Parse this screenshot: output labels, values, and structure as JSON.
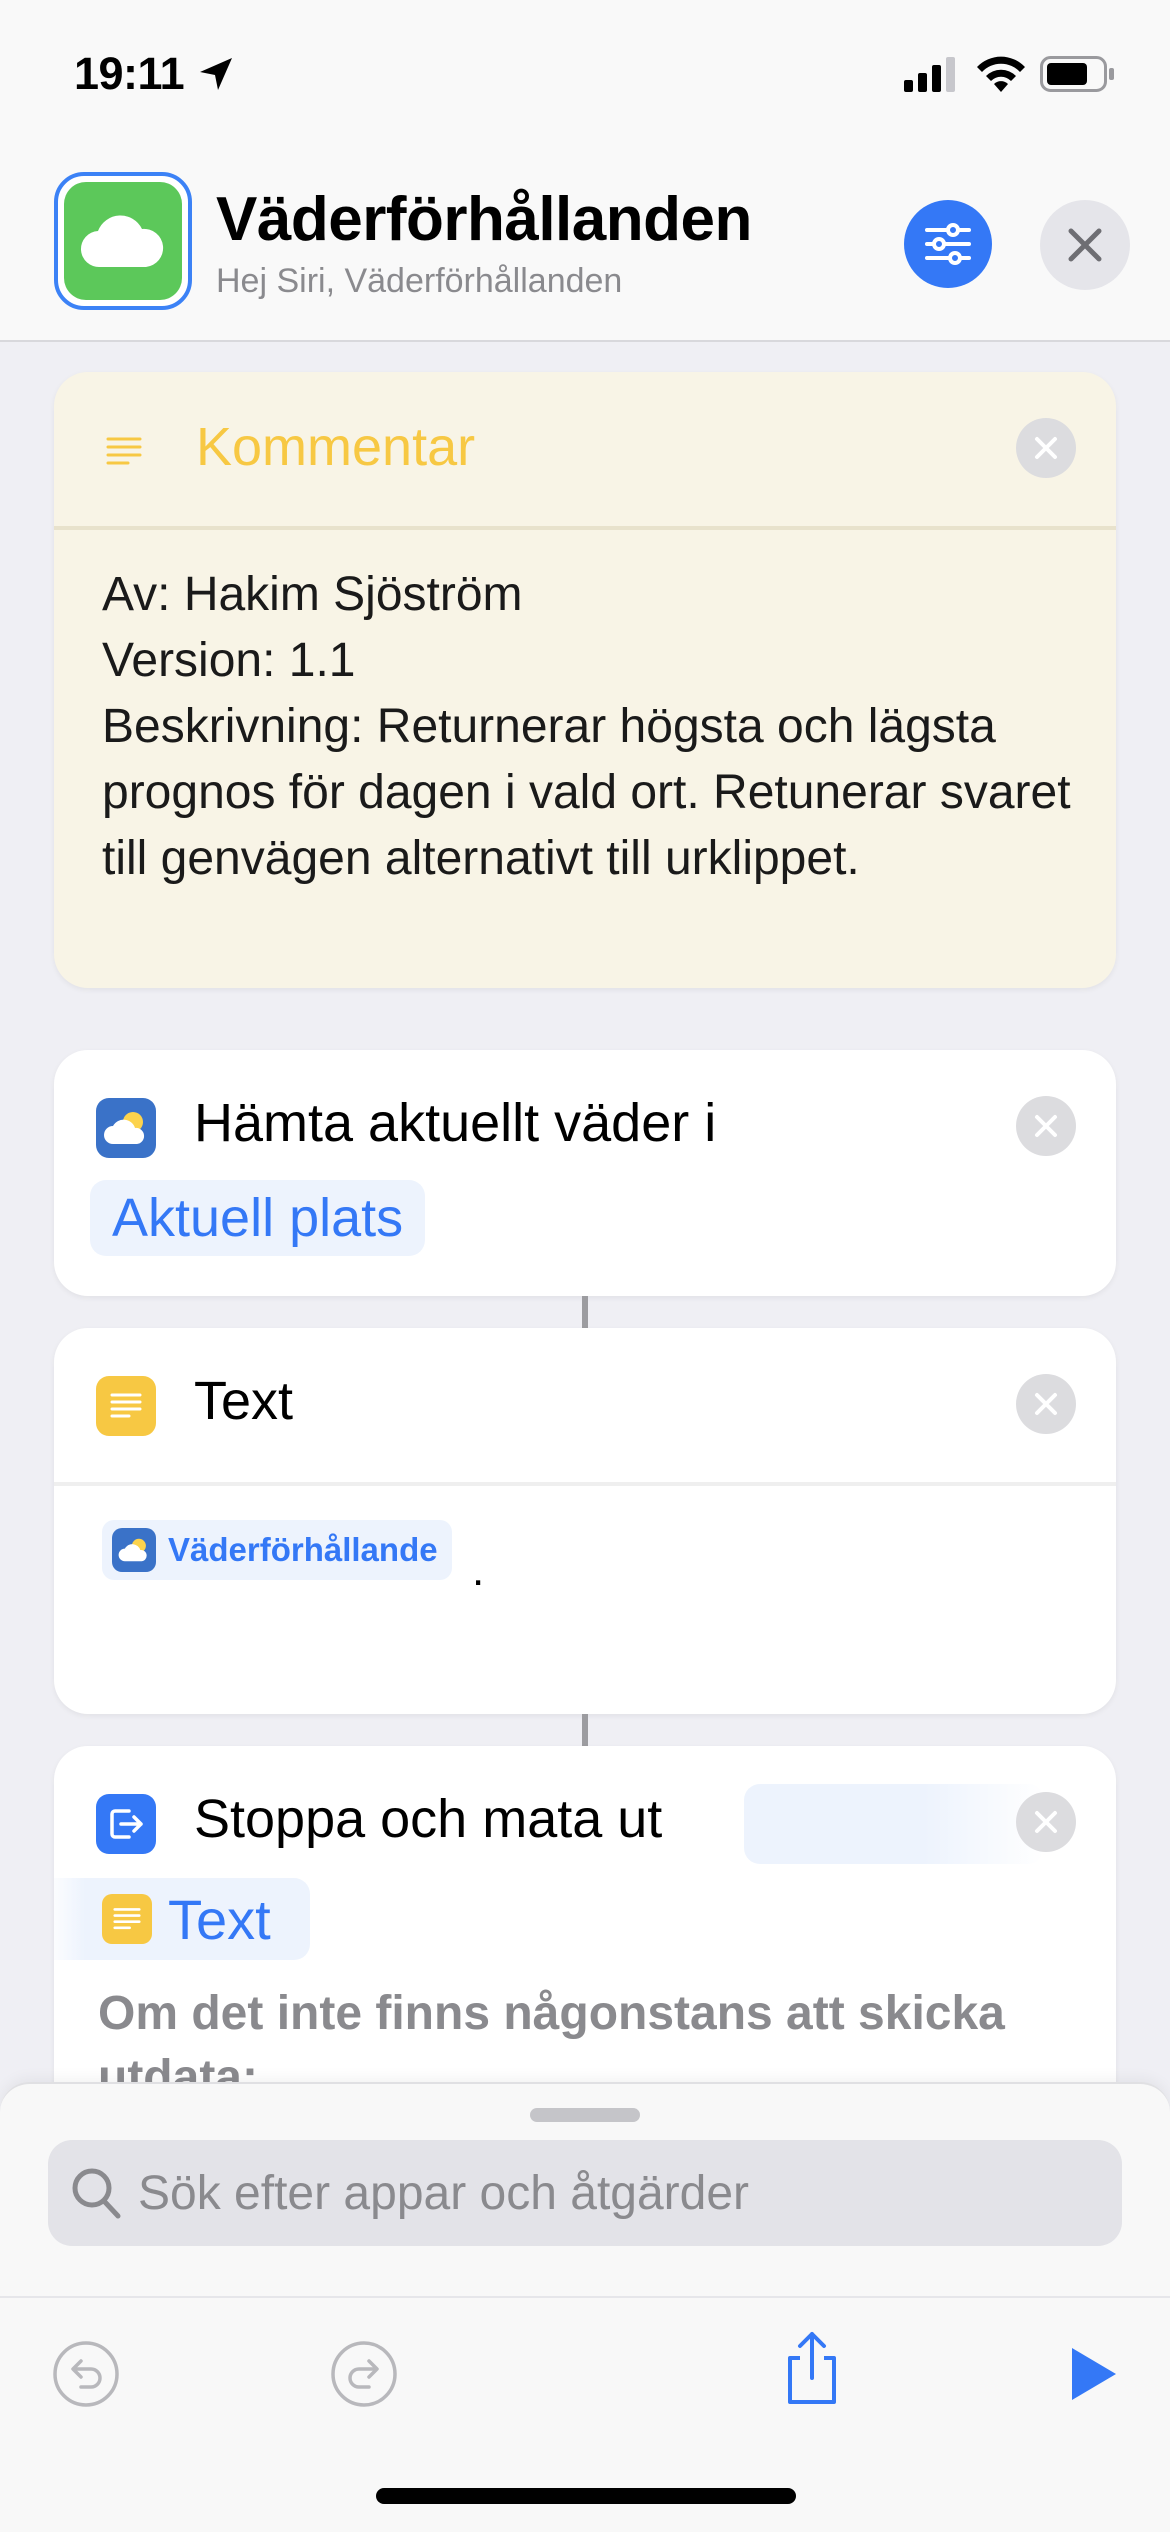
{
  "status_bar": {
    "time": "19:11"
  },
  "header": {
    "title": "Väderförhållanden",
    "subtitle": "Hej Siri, Väderförhållanden"
  },
  "comment": {
    "title": "Kommentar",
    "lines": [
      "Av: Hakim Sjöström",
      "Version: 1.1",
      "Beskrivning: Returnerar högsta och lägsta prognos för dagen i vald ort. Retunerar svaret till genvägen alternativt till urklippet."
    ]
  },
  "weather_action": {
    "title": "Hämta aktuellt väder i",
    "param": "Aktuell plats"
  },
  "text_action": {
    "title": "Text",
    "variable": "Väderförhållande",
    "suffix": "."
  },
  "stop_action": {
    "title": "Stoppa och mata ut",
    "param": "Text",
    "description": "Om det inte finns någonstans att skicka utdata:"
  },
  "search": {
    "placeholder": "Sök efter appar och åtgärder"
  },
  "colors": {
    "accent": "#3478f6",
    "comment_bg": "#f8f4e6",
    "comment_title": "#f7c843",
    "app_icon": "#5cc85a"
  },
  "icons": [
    "location-arrow-icon",
    "cellular-signal-icon",
    "wifi-icon",
    "battery-icon",
    "cloud-icon",
    "sliders-icon",
    "close-icon",
    "comment-lines-icon",
    "weather-icon",
    "text-icon",
    "output-icon",
    "search-icon",
    "undo-icon",
    "redo-icon",
    "share-icon",
    "play-icon"
  ]
}
